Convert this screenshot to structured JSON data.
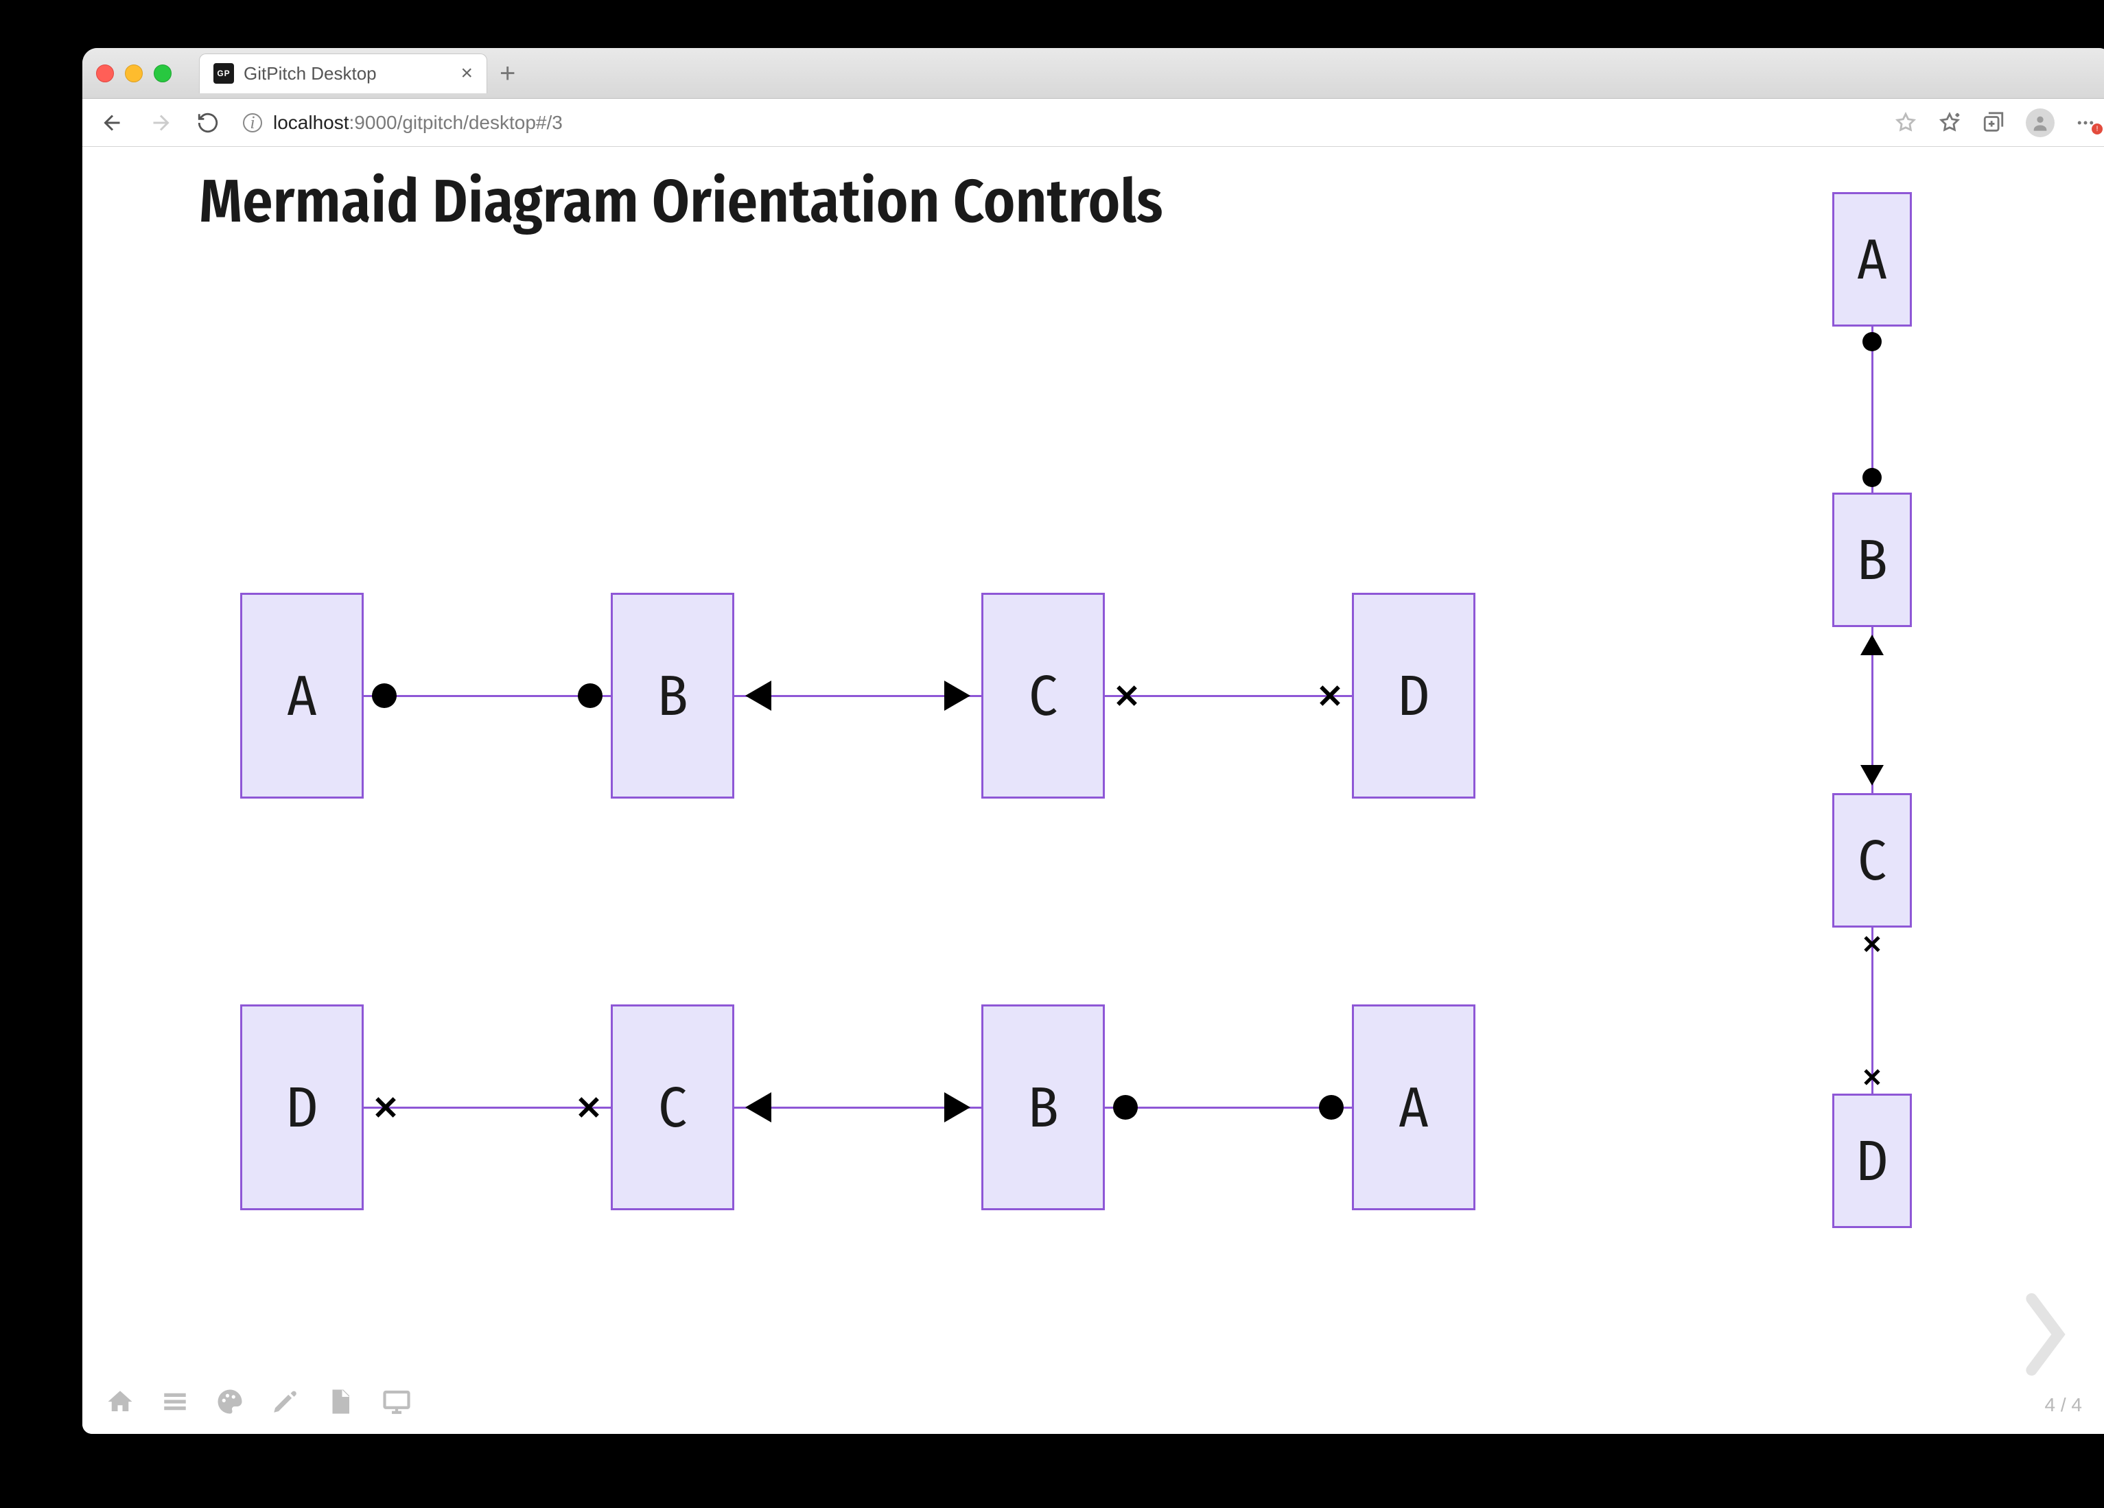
{
  "window": {
    "tab_title": "GitPitch Desktop",
    "favicon_text": "GP"
  },
  "url": {
    "prefix": "localhost",
    "suffix": ":9000/gitpitch/desktop#/3"
  },
  "slide": {
    "title": "Mermaid Diagram Orientation Controls",
    "counter": "4 / 4",
    "diagrams": {
      "lr": {
        "orientation": "LR",
        "nodes": [
          "A",
          "B",
          "C",
          "D"
        ],
        "edges": [
          {
            "from": "A",
            "to": "B",
            "markerFrom": "dot",
            "markerTo": "dot"
          },
          {
            "from": "B",
            "to": "C",
            "markerFrom": "arrow-in",
            "markerTo": "arrow-in"
          },
          {
            "from": "C",
            "to": "D",
            "markerFrom": "cross",
            "markerTo": "cross"
          }
        ]
      },
      "rl": {
        "orientation": "RL",
        "nodes": [
          "D",
          "C",
          "B",
          "A"
        ],
        "edges": [
          {
            "from": "D",
            "to": "C",
            "markerFrom": "cross",
            "markerTo": "cross"
          },
          {
            "from": "C",
            "to": "B",
            "markerFrom": "arrow-in",
            "markerTo": "arrow-in"
          },
          {
            "from": "B",
            "to": "A",
            "markerFrom": "dot",
            "markerTo": "dot"
          }
        ]
      },
      "tb": {
        "orientation": "TB",
        "nodes": [
          "A",
          "B",
          "C",
          "D"
        ],
        "edges": [
          {
            "from": "A",
            "to": "B",
            "markerFrom": "dot",
            "markerTo": "dot"
          },
          {
            "from": "B",
            "to": "C",
            "markerFrom": "arrow-in",
            "markerTo": "arrow-in"
          },
          {
            "from": "C",
            "to": "D",
            "markerFrom": "cross",
            "markerTo": "cross"
          }
        ]
      }
    }
  },
  "colors": {
    "node_fill": "#e7e4fb",
    "node_stroke": "#8e57d6",
    "edge": "#8e57d6",
    "marker": "#000000"
  }
}
